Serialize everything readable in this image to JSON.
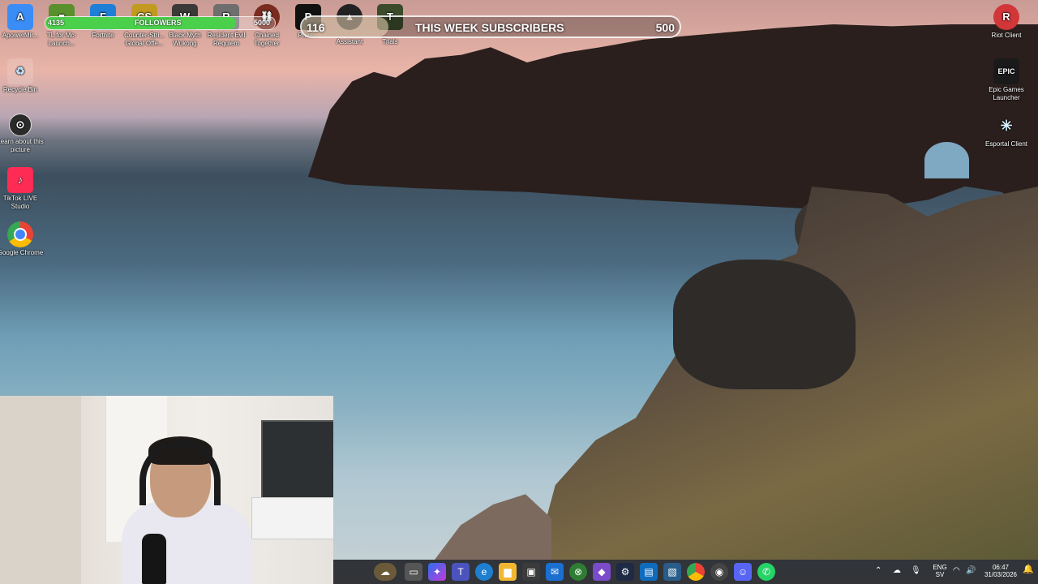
{
  "desktop_icons_top": [
    {
      "label": "ApowerMir...",
      "icon": "apowermirror-icon"
    },
    {
      "label": "TL for Mc-Launch...",
      "icon": "minecraft-icon"
    },
    {
      "label": "Fortnite",
      "icon": "fortnite-icon"
    },
    {
      "label": "Counter-Stri... Global Offe...",
      "icon": "csgo-icon"
    },
    {
      "label": "Black Myth Wukong",
      "icon": "wukong-icon"
    },
    {
      "label": "Resident Evil Requiem",
      "icon": "resident-evil-icon"
    },
    {
      "label": "Chained Together",
      "icon": "chained-together-icon"
    },
    {
      "label": "Phas...",
      "icon": "phasmophobia-icon"
    },
    {
      "label": "Assistant",
      "icon": "assistant-icon"
    },
    {
      "label": "Trials",
      "icon": "trials-icon"
    }
  ],
  "desktop_icons_left": [
    {
      "label": "Recycle Bin",
      "icon": "recycle-bin-icon"
    },
    {
      "label": "Learn about this picture",
      "icon": "learn-picture-icon"
    },
    {
      "label": "TikTok LIVE Studio",
      "icon": "tiktok-icon"
    },
    {
      "label": "Google Chrome",
      "icon": "chrome-icon"
    }
  ],
  "desktop_icons_right": [
    {
      "label": "Riot Client",
      "icon": "riot-icon"
    },
    {
      "label": "Epic Games Launcher",
      "icon": "epic-icon",
      "glyph": "EPIC"
    },
    {
      "label": "Esportal Client",
      "icon": "esportal-icon"
    }
  ],
  "followers_bar": {
    "current": "4135",
    "label": "FOLLOWERS",
    "goal": "5000",
    "progress": 0.83
  },
  "subscribers_bar": {
    "current": "116",
    "label": "THIS WEEK SUBSCRIBERS",
    "goal": "500",
    "progress": 0.23
  },
  "tray": {
    "lang_top": "ENG",
    "lang_bottom": "SV",
    "time": "06:47",
    "date": "31/03/2026"
  },
  "colors": {
    "followers_fill": "#4bd04b",
    "taskbar": "#1c1e22"
  }
}
